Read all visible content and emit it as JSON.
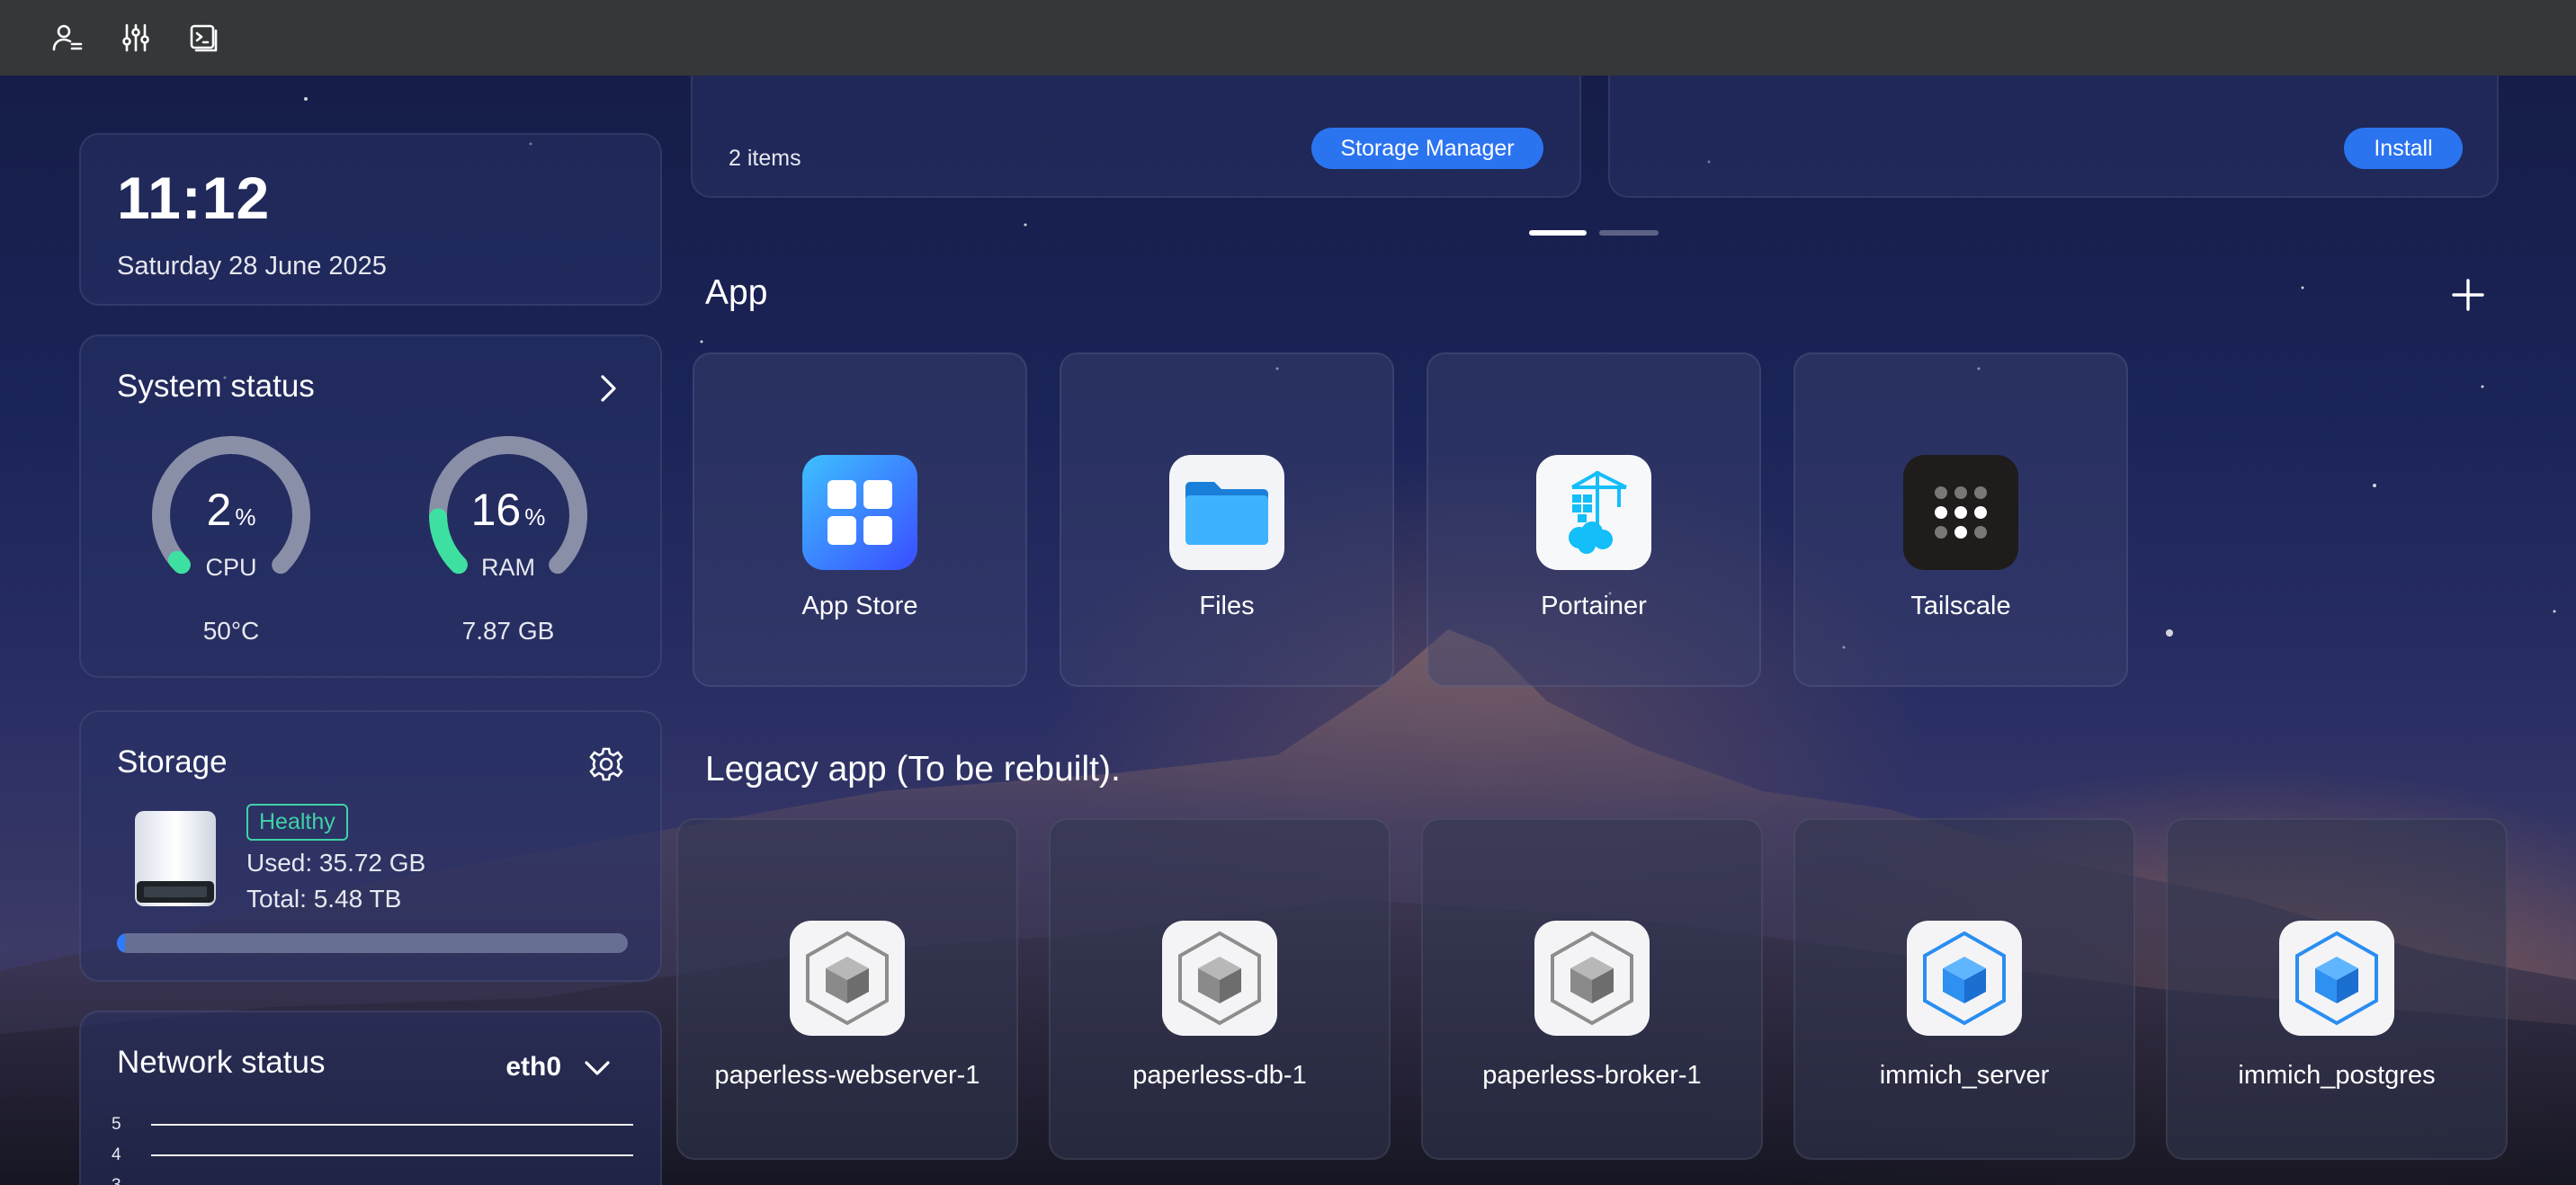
{
  "topbar": {
    "icons": [
      "user-list-icon",
      "sliders-icon",
      "terminal-icon"
    ]
  },
  "clock": {
    "time": "11:12",
    "date": "Saturday 28 June 2025"
  },
  "system_status": {
    "title": "System status",
    "cpu": {
      "value": "2",
      "unit": "%",
      "label": "CPU",
      "sub": "50°C",
      "percent": 2
    },
    "ram": {
      "value": "16",
      "unit": "%",
      "label": "RAM",
      "sub": "7.87 GB",
      "percent": 16
    }
  },
  "storage": {
    "title": "Storage",
    "status": "Healthy",
    "used": "Used: 35.72 GB",
    "total": "Total: 5.48 TB",
    "used_fraction": 0.0064
  },
  "network": {
    "title": "Network status",
    "interface": "eth0",
    "y_ticks": [
      "5",
      "4",
      "3"
    ]
  },
  "top_cards": {
    "left_items": "2 items",
    "left_button": "Storage Manager",
    "right_button": "Install"
  },
  "apps": {
    "title": "App",
    "items": [
      {
        "name": "App Store",
        "icon": "app-store-icon"
      },
      {
        "name": "Files",
        "icon": "folder-icon"
      },
      {
        "name": "Portainer",
        "icon": "portainer-icon"
      },
      {
        "name": "Tailscale",
        "icon": "tailscale-icon"
      }
    ]
  },
  "legacy": {
    "title": "Legacy app (To be rebuilt).",
    "items": [
      {
        "name": "paperless-webserver-1",
        "icon": "grey-cube-icon"
      },
      {
        "name": "paperless-db-1",
        "icon": "grey-cube-icon"
      },
      {
        "name": "paperless-broker-1",
        "icon": "grey-cube-icon"
      },
      {
        "name": "immich_server",
        "icon": "blue-cube-icon"
      },
      {
        "name": "immich_postgres",
        "icon": "blue-cube-icon"
      }
    ]
  },
  "colors": {
    "accent": "#2b74f0",
    "gauge_track": "#8a8fa8",
    "gauge_fill": "#3de0a0",
    "healthy": "#3fd1a6"
  }
}
